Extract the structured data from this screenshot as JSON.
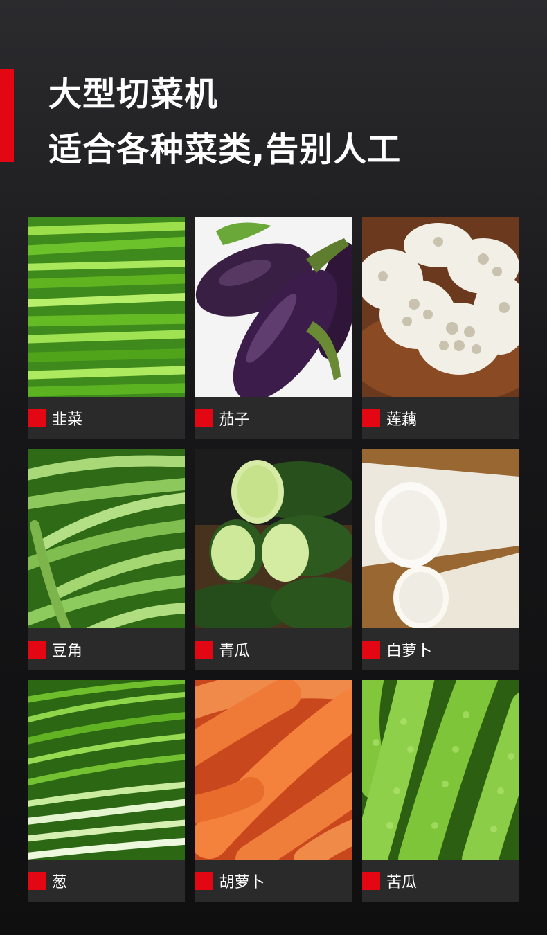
{
  "colors": {
    "accent": "#e30613",
    "background": "#161618",
    "card": "#2a2a2b"
  },
  "header": {
    "title": "大型切菜机",
    "subtitle": "适合各种菜类,告别人工"
  },
  "vegetables": [
    {
      "name": "韭菜",
      "image": "chives-photo"
    },
    {
      "name": "茄子",
      "image": "eggplant-photo"
    },
    {
      "name": "莲藕",
      "image": "lotus-root-photo"
    },
    {
      "name": "豆角",
      "image": "green-beans-photo"
    },
    {
      "name": "青瓜",
      "image": "cucumber-photo"
    },
    {
      "name": "白萝卜",
      "image": "white-radish-photo"
    },
    {
      "name": "葱",
      "image": "scallion-photo"
    },
    {
      "name": "胡萝卜",
      "image": "carrot-photo"
    },
    {
      "name": "苦瓜",
      "image": "bitter-melon-photo"
    }
  ]
}
